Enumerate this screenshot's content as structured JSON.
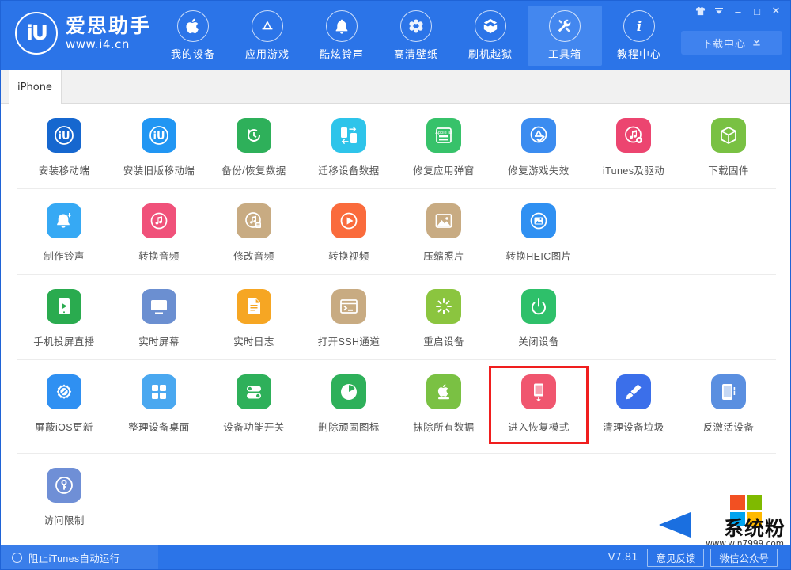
{
  "window": {
    "controls": [
      {
        "name": "skin",
        "glyph": " "
      },
      {
        "name": "menu",
        "glyph": " "
      },
      {
        "name": "minimize",
        "glyph": "–"
      },
      {
        "name": "maximize",
        "glyph": "□"
      },
      {
        "name": "close",
        "glyph": "✕"
      }
    ]
  },
  "brand": {
    "mark": "iU",
    "name": "爱思助手",
    "url": "www.i4.cn"
  },
  "nav": {
    "items": [
      {
        "label": "我的设备",
        "icon": "apple-icon",
        "active": false
      },
      {
        "label": "应用游戏",
        "icon": "appstore-icon",
        "active": false
      },
      {
        "label": "酷炫铃声",
        "icon": "bell-icon",
        "active": false
      },
      {
        "label": "高清壁纸",
        "icon": "flower-icon",
        "active": false
      },
      {
        "label": "刷机越狱",
        "icon": "box-open-icon",
        "active": false
      },
      {
        "label": "工具箱",
        "icon": "tools-icon",
        "active": true
      },
      {
        "label": "教程中心",
        "icon": "info-icon",
        "active": false
      }
    ]
  },
  "download_button": {
    "label": "下载中心",
    "icon": "download-icon"
  },
  "device_tabs": {
    "tabs": [
      {
        "label": "iPhone",
        "active": true
      }
    ]
  },
  "toolbox": {
    "rows": [
      {
        "items": [
          {
            "label": "安装移动端",
            "icon": "i4-app-icon",
            "color": "#1667cf",
            "highlight": false
          },
          {
            "label": "安装旧版移动端",
            "icon": "i4-app-old-icon",
            "color": "#2196f3",
            "highlight": false
          },
          {
            "label": "备份/恢复数据",
            "icon": "backup-restore-icon",
            "color": "#2eb05a",
            "highlight": false
          },
          {
            "label": "迁移设备数据",
            "icon": "migrate-data-icon",
            "color": "#2ec4ea",
            "highlight": false
          },
          {
            "label": "修复应用弹窗",
            "icon": "appleid-popup-icon",
            "color": "#37c26a",
            "highlight": false
          },
          {
            "label": "修复游戏失效",
            "icon": "fix-game-icon",
            "color": "#3b8cf0",
            "highlight": false
          },
          {
            "label": "iTunes及驱动",
            "icon": "itunes-driver-icon",
            "color": "#ec4570",
            "highlight": false
          },
          {
            "label": "下载固件",
            "icon": "firmware-box-icon",
            "color": "#79c143",
            "highlight": false
          }
        ]
      },
      {
        "items": [
          {
            "label": "制作铃声",
            "icon": "make-ringtone-icon",
            "color": "#36a9f4",
            "highlight": false
          },
          {
            "label": "转换音频",
            "icon": "convert-audio-icon",
            "color": "#f0517a",
            "highlight": false
          },
          {
            "label": "修改音频",
            "icon": "edit-audio-icon",
            "color": "#c8ab82",
            "highlight": false
          },
          {
            "label": "转换视频",
            "icon": "convert-video-icon",
            "color": "#fa6b3c",
            "highlight": false
          },
          {
            "label": "压缩照片",
            "icon": "compress-photo-icon",
            "color": "#c8ab82",
            "highlight": false
          },
          {
            "label": "转换HEIC图片",
            "icon": "convert-heic-icon",
            "color": "#2f90f2",
            "highlight": false
          }
        ]
      },
      {
        "items": [
          {
            "label": "手机投屏直播",
            "icon": "screen-cast-icon",
            "color": "#2aab4f",
            "highlight": false
          },
          {
            "label": "实时屏幕",
            "icon": "live-screen-icon",
            "color": "#6b8fd1",
            "highlight": false
          },
          {
            "label": "实时日志",
            "icon": "live-log-icon",
            "color": "#f6a623",
            "highlight": false
          },
          {
            "label": "打开SSH通道",
            "icon": "ssh-terminal-icon",
            "color": "#c8ab82",
            "highlight": false
          },
          {
            "label": "重启设备",
            "icon": "reboot-icon",
            "color": "#8bc53f",
            "highlight": false
          },
          {
            "label": "关闭设备",
            "icon": "power-off-icon",
            "color": "#2ec06a",
            "highlight": false
          }
        ]
      },
      {
        "items": [
          {
            "label": "屏蔽iOS更新",
            "icon": "block-ios-update-icon",
            "color": "#2f90f2",
            "highlight": false
          },
          {
            "label": "整理设备桌面",
            "icon": "organize-desktop-icon",
            "color": "#4aa8f0",
            "highlight": false
          },
          {
            "label": "设备功能开关",
            "icon": "feature-toggle-icon",
            "color": "#2eb05a",
            "highlight": false
          },
          {
            "label": "删除顽固图标",
            "icon": "delete-stuck-icon",
            "color": "#2eb05a",
            "highlight": false
          },
          {
            "label": "抹除所有数据",
            "icon": "erase-all-icon",
            "color": "#7ac143",
            "highlight": false
          },
          {
            "label": "进入恢复模式",
            "icon": "recovery-mode-icon",
            "color": "#f0566f",
            "highlight": true
          },
          {
            "label": "清理设备垃圾",
            "icon": "clean-junk-icon",
            "color": "#3b6fea",
            "highlight": false
          },
          {
            "label": "反激活设备",
            "icon": "deactivate-icon",
            "color": "#5a8fe0",
            "highlight": false
          }
        ]
      },
      {
        "items": [
          {
            "label": "访问限制",
            "icon": "access-restriction-icon",
            "color": "#6f8fd6",
            "highlight": false
          }
        ]
      }
    ]
  },
  "statusbar": {
    "block_itunes_label": "阻止iTunes自动运行",
    "version": "V7.81",
    "buttons": [
      {
        "label": "意见反馈"
      },
      {
        "label": "微信公众号"
      }
    ]
  },
  "watermark": {
    "title": "系统粉",
    "url": "www.win7999.com"
  },
  "colors": {
    "header_blue": "#2b74e8",
    "active_nav": "#4387ef",
    "highlight_red": "#f01e1e"
  }
}
